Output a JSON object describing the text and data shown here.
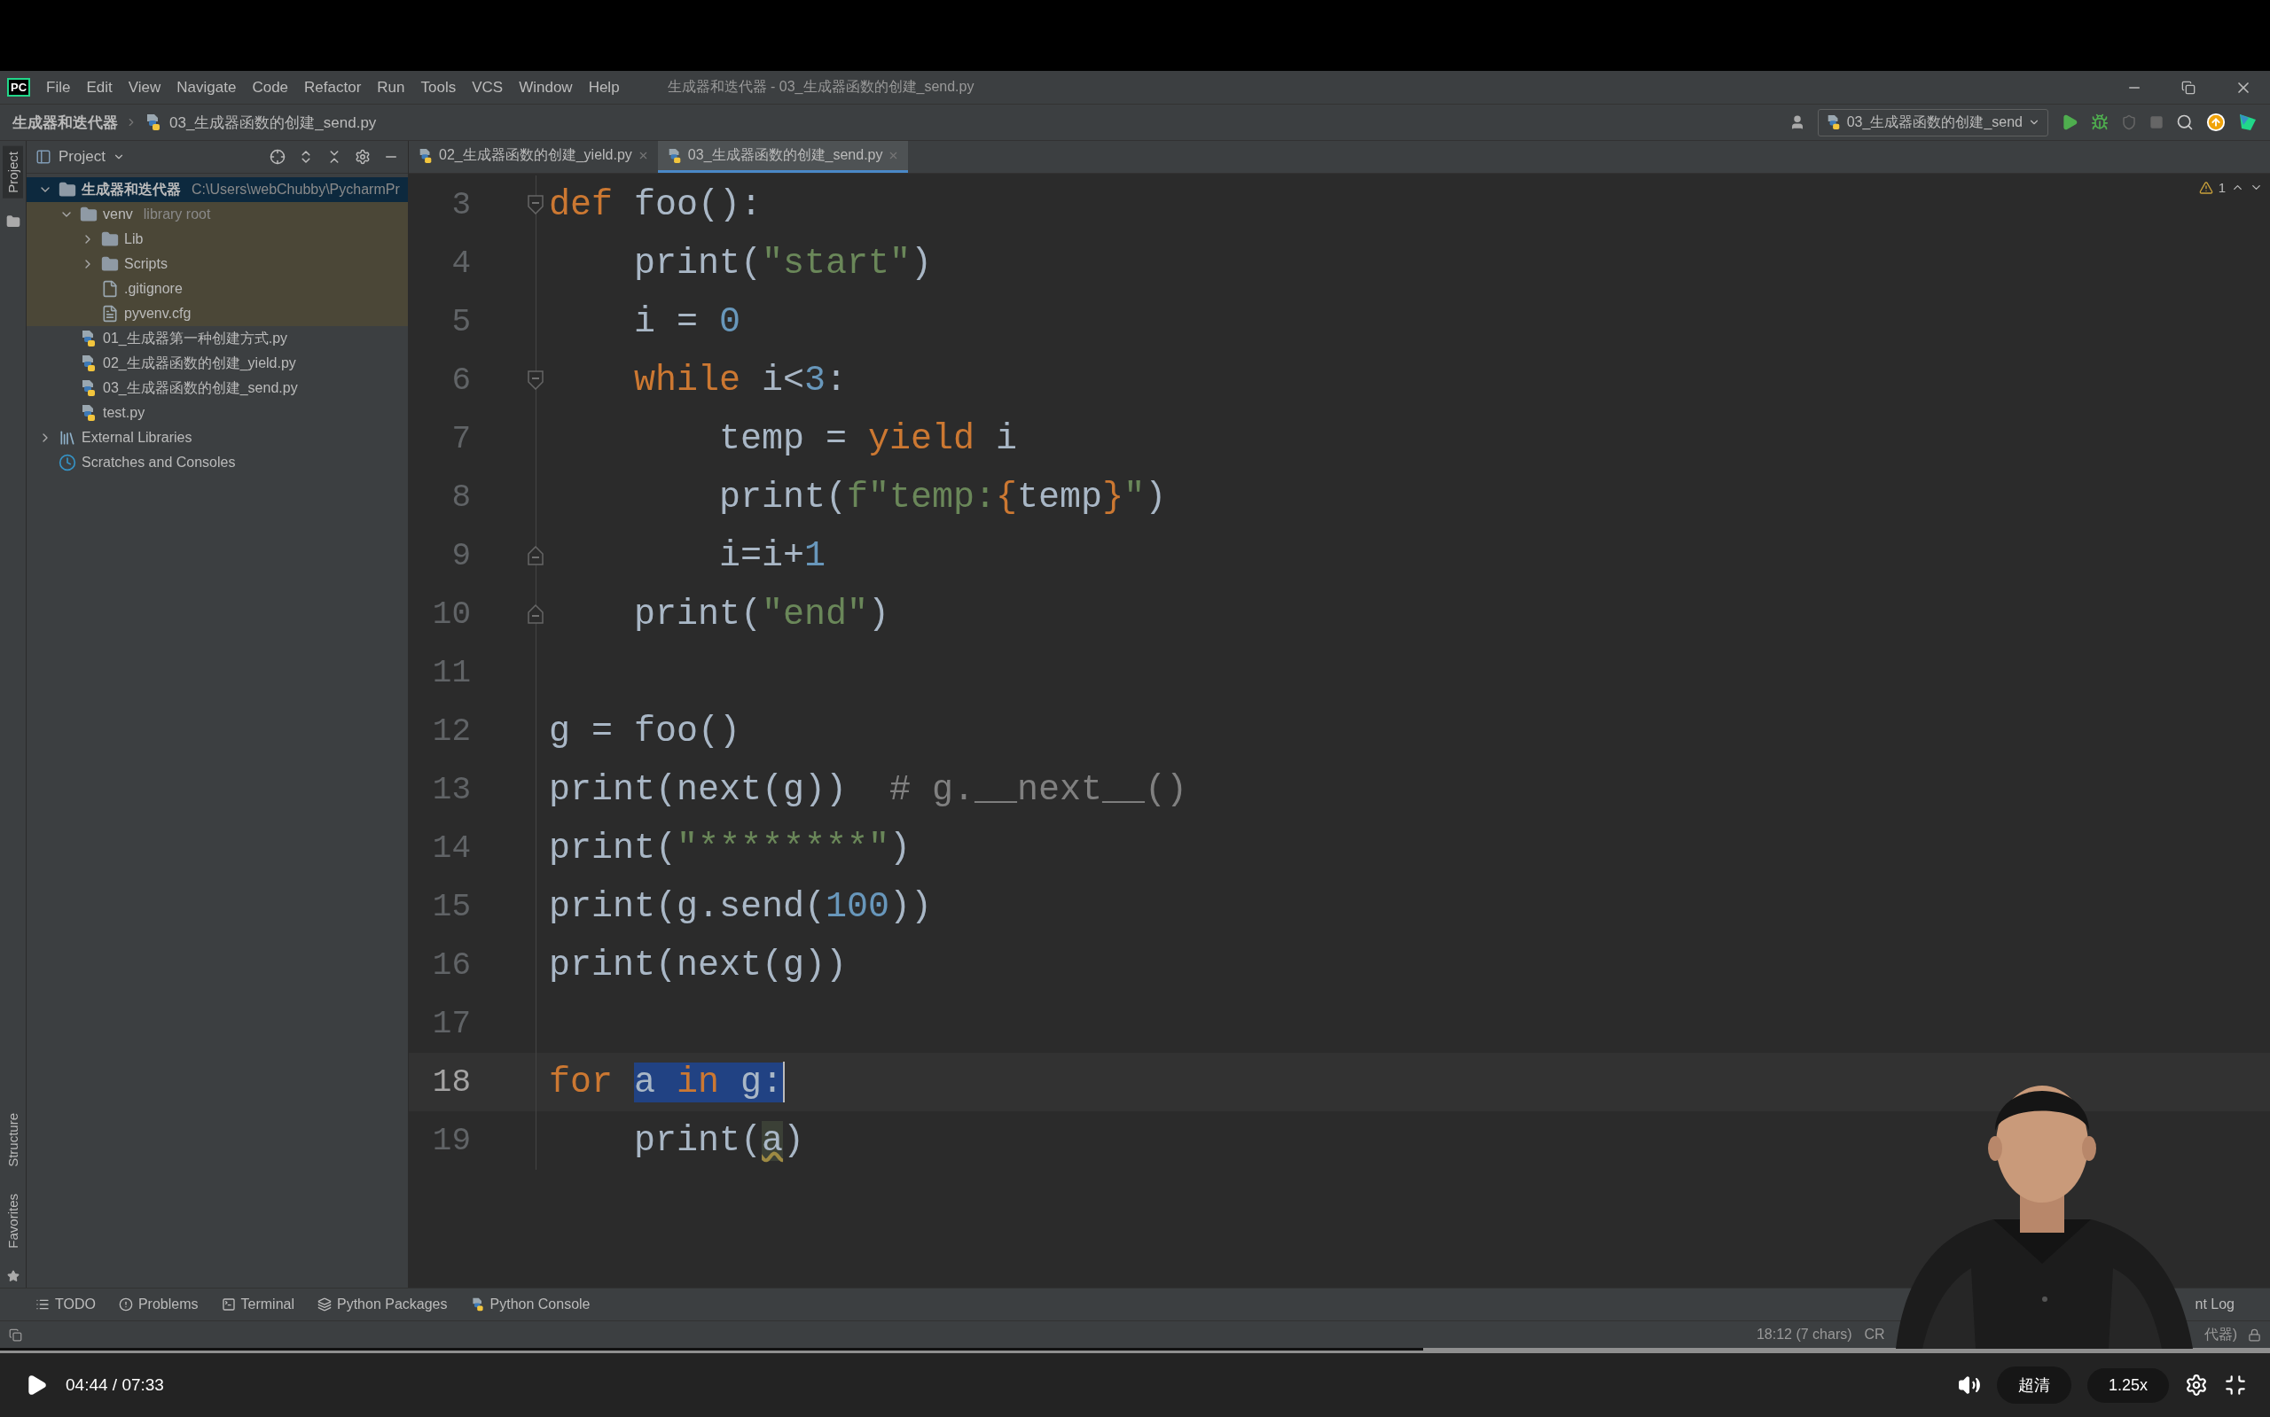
{
  "menu_bar": {
    "logo": "PC",
    "items": [
      "File",
      "Edit",
      "View",
      "Navigate",
      "Code",
      "Refactor",
      "Run",
      "Tools",
      "VCS",
      "Window",
      "Help"
    ],
    "title": "生成器和迭代器 - 03_生成器函数的创建_send.py"
  },
  "nav_bar": {
    "breadcrumbs": [
      "生成器和迭代器",
      "03_生成器函数的创建_send.py"
    ],
    "run_config": "03_生成器函数的创建_send"
  },
  "side_strip": {
    "top": [
      {
        "label": "Project",
        "selected": true
      }
    ],
    "bottom": [
      {
        "label": "Structure",
        "selected": false
      },
      {
        "label": "Favorites",
        "selected": false
      }
    ]
  },
  "project": {
    "title": "Project",
    "tree": [
      {
        "label": "生成器和迭代器",
        "hint": "C:\\Users\\webChubby\\PycharmPr",
        "kind": "folder",
        "expanded": true,
        "selected": true,
        "shaded": false,
        "children": [
          {
            "label": "venv",
            "hint": "library root",
            "kind": "folder",
            "expanded": true,
            "selected": false,
            "shaded": true,
            "children": [
              {
                "label": "Lib",
                "kind": "folder",
                "expanded": false,
                "selected": false
              },
              {
                "label": "Scripts",
                "kind": "folder",
                "expanded": false,
                "selected": false
              },
              {
                "label": ".gitignore",
                "kind": "ignore-file",
                "selected": false
              },
              {
                "label": "pyvenv.cfg",
                "kind": "text-file",
                "selected": false
              }
            ]
          },
          {
            "label": "01_生成器第一种创建方式.py",
            "kind": "python-file",
            "selected": false,
            "shaded": false
          },
          {
            "label": "02_生成器函数的创建_yield.py",
            "kind": "python-file",
            "selected": false,
            "shaded": false
          },
          {
            "label": "03_生成器函数的创建_send.py",
            "kind": "python-file",
            "selected": false,
            "shaded": false
          },
          {
            "label": "test.py",
            "kind": "python-file",
            "selected": false,
            "shaded": false
          }
        ]
      },
      {
        "label": "External Libraries",
        "kind": "libraries",
        "expanded": false,
        "selected": false,
        "shaded": false
      },
      {
        "label": "Scratches and Consoles",
        "kind": "scratches",
        "selected": false,
        "shaded": false
      }
    ]
  },
  "editor": {
    "tabs": [
      {
        "label": "02_生成器函数的创建_yield.py",
        "selected": false
      },
      {
        "label": "03_生成器函数的创建_send.py",
        "selected": true
      }
    ],
    "warnings": "1",
    "lines": [
      {
        "number": "3",
        "kind": "fold-start",
        "current": false,
        "tokens": [
          {
            "kind": "keyword",
            "text": "def",
            "selected": false
          },
          {
            "kind": "plain",
            "text": " foo():",
            "selected": false
          }
        ]
      },
      {
        "number": "4",
        "kind": "code",
        "current": false,
        "tokens": [
          {
            "kind": "plain",
            "text": "    print(",
            "selected": false
          },
          {
            "kind": "string",
            "text": "\"start\"",
            "selected": false
          },
          {
            "kind": "plain",
            "text": ")",
            "selected": false
          }
        ]
      },
      {
        "number": "5",
        "kind": "code",
        "current": false,
        "tokens": [
          {
            "kind": "plain",
            "text": "    i = ",
            "selected": false
          },
          {
            "kind": "number",
            "text": "0",
            "selected": false
          }
        ]
      },
      {
        "number": "6",
        "kind": "fold-start",
        "current": false,
        "tokens": [
          {
            "kind": "keyword",
            "text": "    while",
            "selected": false
          },
          {
            "kind": "plain",
            "text": " i<",
            "selected": false
          },
          {
            "kind": "number",
            "text": "3",
            "selected": false
          },
          {
            "kind": "plain",
            "text": ":",
            "selected": false
          }
        ]
      },
      {
        "number": "7",
        "kind": "code",
        "current": false,
        "tokens": [
          {
            "kind": "plain",
            "text": "        temp = ",
            "selected": false
          },
          {
            "kind": "keyword",
            "text": "yield",
            "selected": false
          },
          {
            "kind": "plain",
            "text": " i",
            "selected": false
          }
        ]
      },
      {
        "number": "8",
        "kind": "code",
        "current": false,
        "tokens": [
          {
            "kind": "plain",
            "text": "        print(",
            "selected": false
          },
          {
            "kind": "string",
            "text": "f\"temp:",
            "selected": false
          },
          {
            "kind": "brace",
            "text": "{",
            "selected": false
          },
          {
            "kind": "plain",
            "text": "temp",
            "selected": false
          },
          {
            "kind": "brace",
            "text": "}",
            "selected": false
          },
          {
            "kind": "string",
            "text": "\"",
            "selected": false
          },
          {
            "kind": "plain",
            "text": ")",
            "selected": false
          }
        ]
      },
      {
        "number": "9",
        "kind": "fold-end",
        "current": false,
        "tokens": [
          {
            "kind": "plain",
            "text": "        i=i+",
            "selected": false
          },
          {
            "kind": "number",
            "text": "1",
            "selected": false
          }
        ]
      },
      {
        "number": "10",
        "kind": "fold-end",
        "current": false,
        "tokens": [
          {
            "kind": "plain",
            "text": "    print(",
            "selected": false
          },
          {
            "kind": "string",
            "text": "\"end\"",
            "selected": false
          },
          {
            "kind": "plain",
            "text": ")",
            "selected": false
          }
        ]
      },
      {
        "number": "11",
        "kind": "code",
        "current": false
      },
      {
        "number": "12",
        "kind": "code",
        "current": false,
        "tokens": [
          {
            "kind": "plain",
            "text": "g = foo()",
            "selected": false
          }
        ]
      },
      {
        "number": "13",
        "kind": "code",
        "current": false,
        "tokens": [
          {
            "kind": "plain",
            "text": "print(next(g))  ",
            "selected": false
          },
          {
            "kind": "comment",
            "text": "# g.__next__()",
            "selected": false
          }
        ]
      },
      {
        "number": "14",
        "kind": "code",
        "current": false,
        "tokens": [
          {
            "kind": "plain",
            "text": "print(",
            "selected": false
          },
          {
            "kind": "string",
            "text": "\"********\"",
            "selected": false
          },
          {
            "kind": "plain",
            "text": ")",
            "selected": false
          }
        ]
      },
      {
        "number": "15",
        "kind": "code",
        "current": false,
        "tokens": [
          {
            "kind": "plain",
            "text": "print(g.send(",
            "selected": false
          },
          {
            "kind": "number",
            "text": "100",
            "selected": false
          },
          {
            "kind": "plain",
            "text": "))",
            "selected": false
          }
        ]
      },
      {
        "number": "16",
        "kind": "code",
        "current": false,
        "tokens": [
          {
            "kind": "plain",
            "text": "print(next(g))",
            "selected": false
          }
        ]
      },
      {
        "number": "17",
        "kind": "code",
        "current": false
      },
      {
        "number": "18",
        "kind": "code",
        "current": true,
        "tokens": [
          {
            "kind": "keyword",
            "text": "for ",
            "selected": false
          },
          {
            "kind": "plain",
            "text": "a",
            "selected": true
          },
          {
            "kind": "keyword",
            "text": " in ",
            "selected": true
          },
          {
            "kind": "plain",
            "text": "g:",
            "selected": true
          }
        ]
      },
      {
        "number": "19",
        "kind": "code",
        "current": false,
        "tokens": [
          {
            "kind": "plain",
            "text": "    print(",
            "selected": false
          },
          {
            "kind": "usage",
            "text": "a",
            "selected": false
          },
          {
            "kind": "plain",
            "text": ")",
            "selected": false
          }
        ]
      }
    ]
  },
  "tool_tabs": [
    {
      "label": "TODO",
      "kind": "todo"
    },
    {
      "label": "Problems",
      "kind": "problems"
    },
    {
      "label": "Terminal",
      "kind": "terminal"
    },
    {
      "label": "Python Packages",
      "kind": "packages"
    },
    {
      "label": "Python Console",
      "kind": "console"
    }
  ],
  "tool_tabs_right": "nt Log",
  "status_bar": {
    "position": "18:12 (7 chars)",
    "line_separator": "CR",
    "branch": "代器)"
  },
  "video": {
    "time": "04:44 / 07:33",
    "level": 0.627,
    "quality": "超清",
    "speed": "1.25x"
  }
}
